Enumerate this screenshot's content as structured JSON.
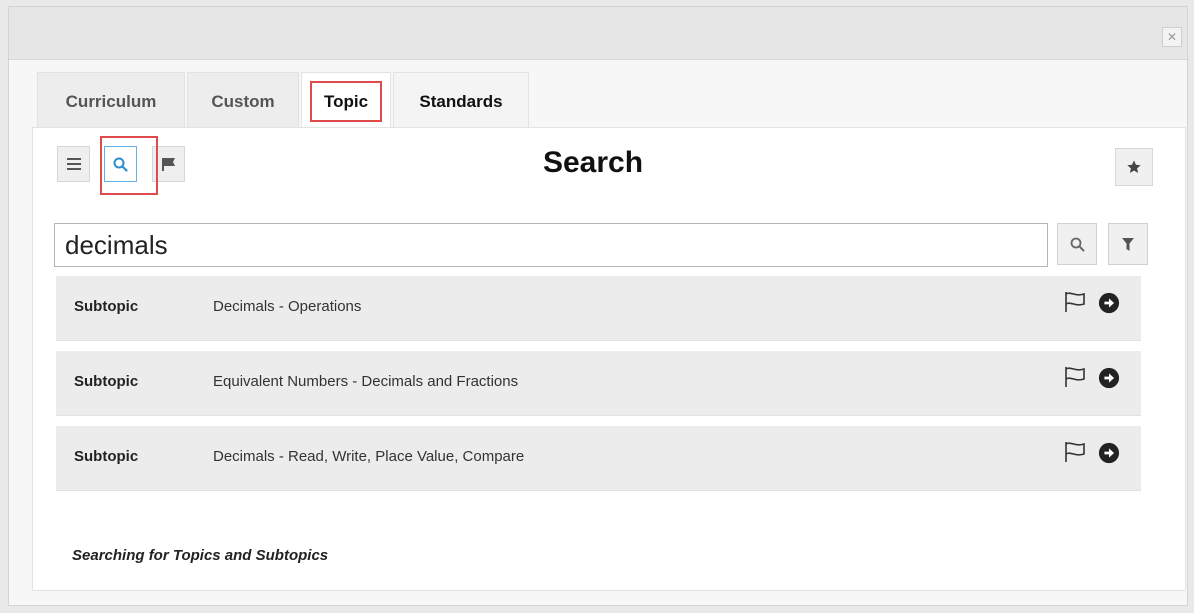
{
  "window": {
    "close_glyph": "✕"
  },
  "tabs": [
    {
      "label": "Curriculum"
    },
    {
      "label": "Custom"
    },
    {
      "label": "Topic"
    },
    {
      "label": "Standards"
    }
  ],
  "toolbar": {
    "title": "Search",
    "icons": [
      "list-icon",
      "search-icon",
      "flag-icon",
      "star-icon"
    ]
  },
  "search": {
    "value": "decimals"
  },
  "results": [
    {
      "type": "Subtopic",
      "label": "Decimals - Operations"
    },
    {
      "type": "Subtopic",
      "label": "Equivalent Numbers - Decimals and Fractions"
    },
    {
      "type": "Subtopic",
      "label": "Decimals - Read, Write, Place Value, Compare"
    }
  ],
  "footer": {
    "note": "Searching for Topics and Subtopics"
  },
  "colors": {
    "highlight": "#e04a4a",
    "active_border": "#5fb6e6"
  }
}
